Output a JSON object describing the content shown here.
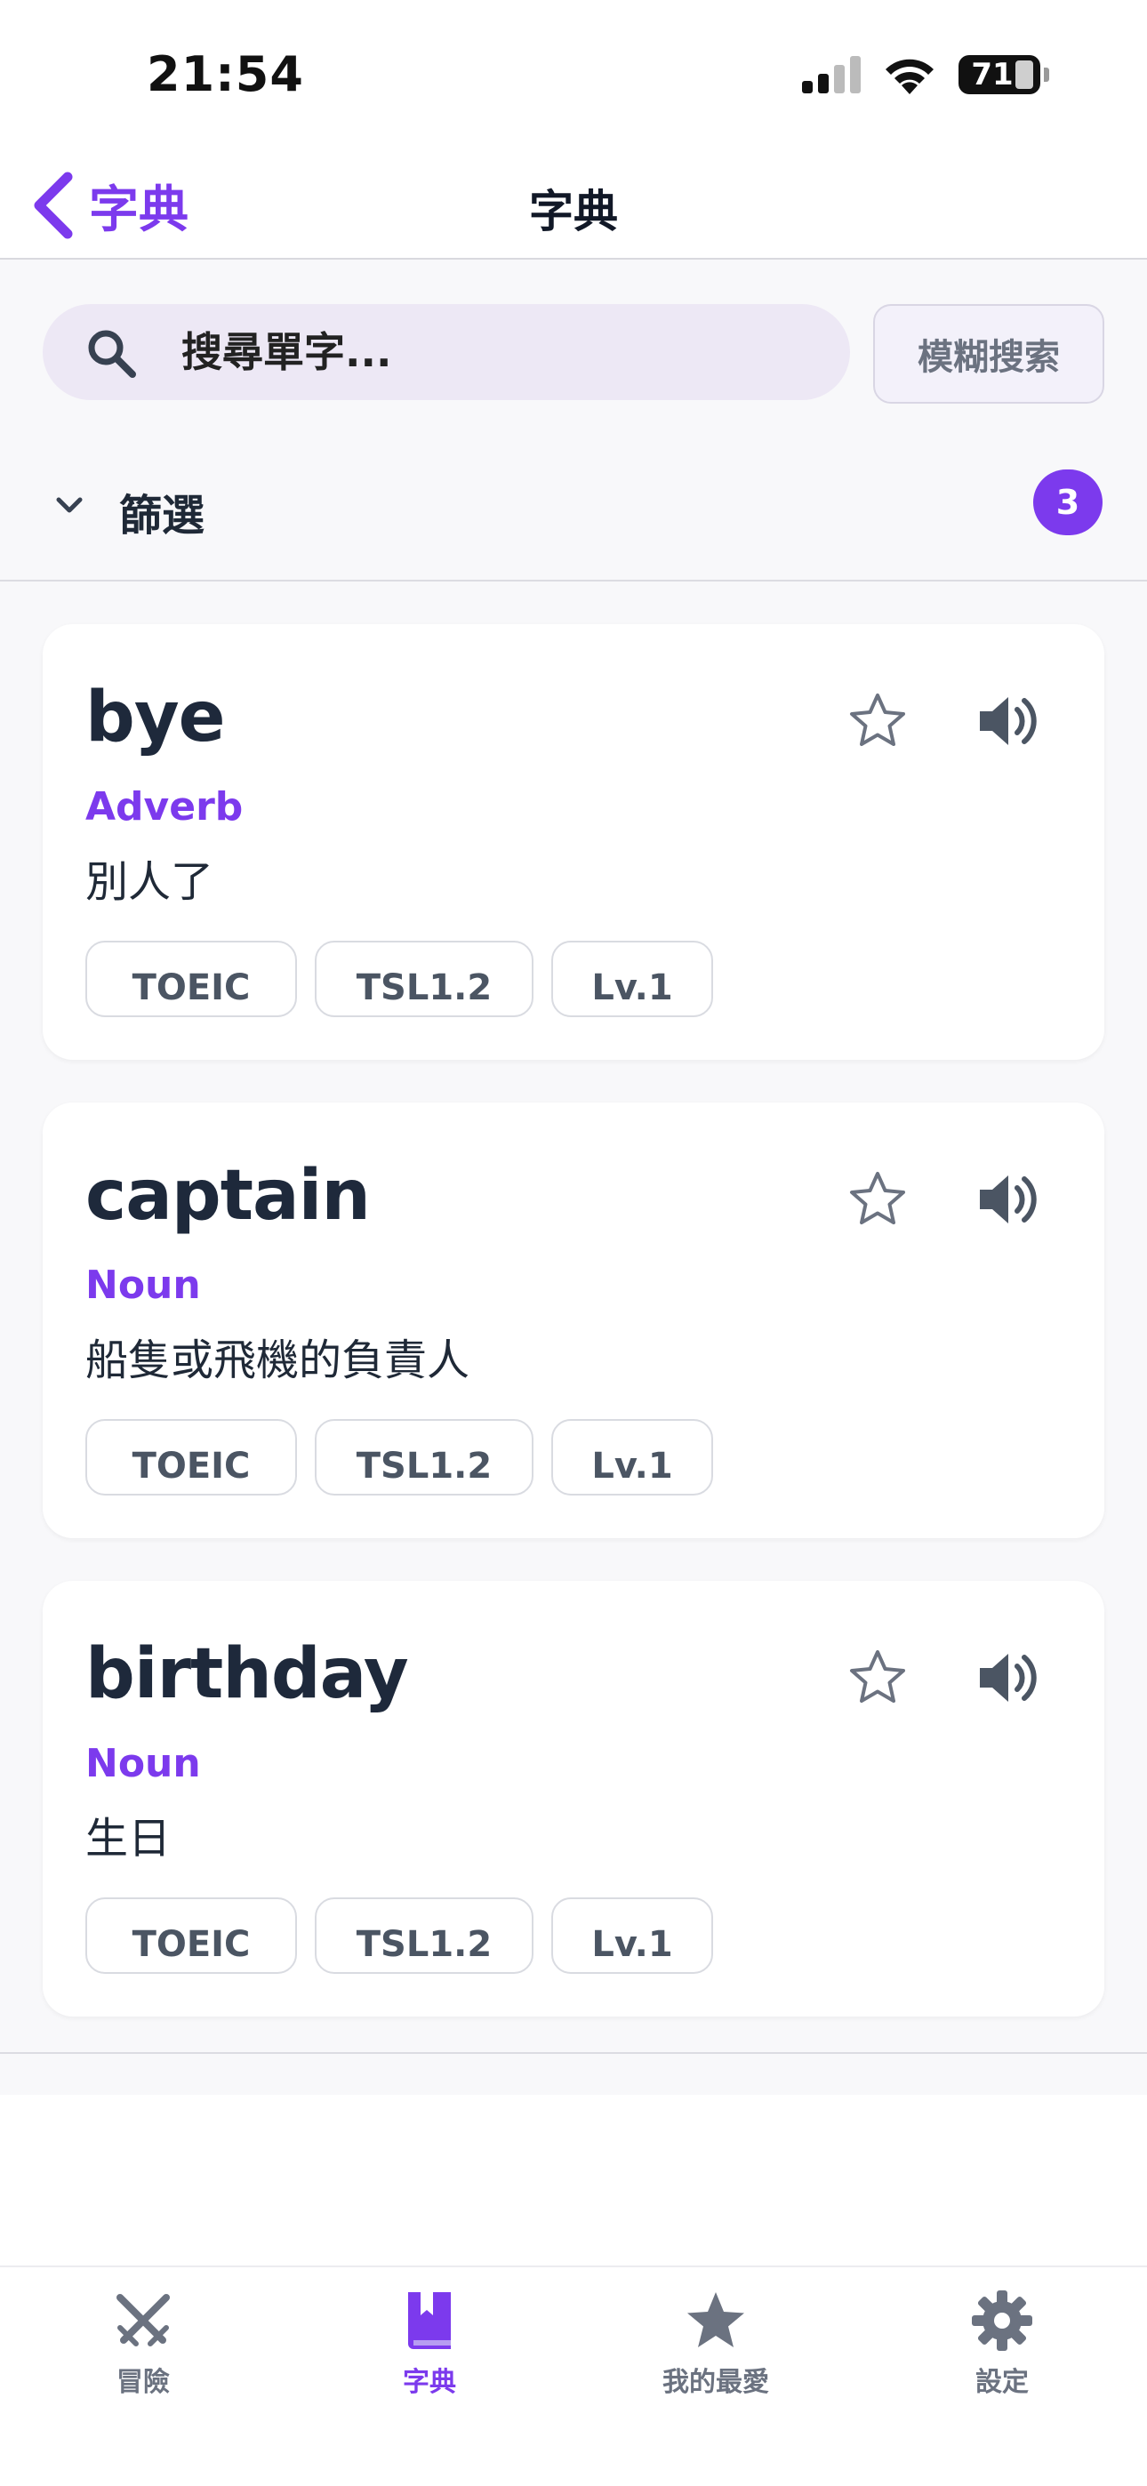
{
  "status_bar": {
    "time": "21:54",
    "battery": "71"
  },
  "nav": {
    "back_label": "字典",
    "title": "字典"
  },
  "search": {
    "placeholder": "搜尋單字...",
    "value": "",
    "fuzzy_label": "模糊搜索"
  },
  "filter": {
    "label": "篩選",
    "count": "3"
  },
  "words": [
    {
      "word": "bye",
      "pos": "Adverb",
      "definition": "別人了",
      "tags": [
        "TOEIC",
        "TSL1.2",
        "Lv.1"
      ]
    },
    {
      "word": "captain",
      "pos": "Noun",
      "definition": "船隻或飛機的負責人",
      "tags": [
        "TOEIC",
        "TSL1.2",
        "Lv.1"
      ]
    },
    {
      "word": "birthday",
      "pos": "Noun",
      "definition": "生日",
      "tags": [
        "TOEIC",
        "TSL1.2",
        "Lv.1"
      ]
    }
  ],
  "tabs": [
    {
      "label": "冒險",
      "icon": "swords-icon"
    },
    {
      "label": "字典",
      "icon": "bookmark-book-icon"
    },
    {
      "label": "我的最愛",
      "icon": "star-icon"
    },
    {
      "label": "設定",
      "icon": "gear-icon"
    }
  ],
  "colors": {
    "accent": "#7c3aed",
    "text_dark": "#1e293b",
    "muted": "#6b7280"
  }
}
